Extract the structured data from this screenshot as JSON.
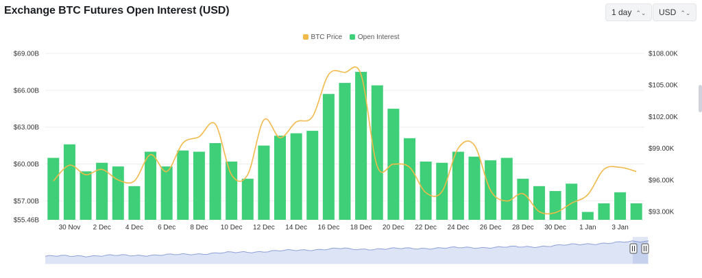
{
  "header": {
    "title": "Exchange BTC Futures Open Interest (USD)",
    "interval_select": "1 day",
    "currency_select": "USD"
  },
  "colors": {
    "bars": "#3ecf78",
    "price_line": "#f1b94a",
    "grid": "#eeeeee",
    "navigator_fill": "#dde4f6",
    "navigator_line": "#8da0d8"
  },
  "icons": {
    "select_chevron": "chevron-updown-icon",
    "navigator_handles": "pause-handle-icon"
  },
  "chart_data": {
    "type": "bar",
    "legend": [
      "BTC Price",
      "Open Interest"
    ],
    "x_tick_labels": [
      "30 Nov",
      "2 Dec",
      "4 Dec",
      "6 Dec",
      "8 Dec",
      "10 Dec",
      "12 Dec",
      "14 Dec",
      "16 Dec",
      "18 Dec",
      "20 Dec",
      "22 Dec",
      "24 Dec",
      "26 Dec",
      "28 Dec",
      "30 Dec",
      "1 Jan",
      "3 Jan"
    ],
    "left_axis": {
      "ticks": [
        {
          "value": 55.46,
          "label": "$55.46B"
        },
        {
          "value": 57.0,
          "label": "$57.00B"
        },
        {
          "value": 60.0,
          "label": "$60.00B"
        },
        {
          "value": 63.0,
          "label": "$63.00B"
        },
        {
          "value": 66.0,
          "label": "$66.00B"
        },
        {
          "value": 69.0,
          "label": "$69.00B"
        }
      ],
      "range": [
        55.46,
        69.0
      ]
    },
    "right_axis": {
      "ticks": [
        {
          "value": 93000,
          "label": "$93.00K"
        },
        {
          "value": 96000,
          "label": "$96.00K"
        },
        {
          "value": 99000,
          "label": "$99.00K"
        },
        {
          "value": 102000,
          "label": "$102.00K"
        },
        {
          "value": 105000,
          "label": "$105.00K"
        },
        {
          "value": 108000,
          "label": "$108.00K"
        }
      ],
      "range": [
        92600,
        108000
      ]
    },
    "series": [
      {
        "name": "Open Interest",
        "axis": "left",
        "values": [
          60.5,
          61.6,
          59.4,
          60.1,
          59.8,
          58.2,
          61.0,
          59.8,
          61.1,
          61.0,
          61.7,
          60.2,
          58.8,
          61.5,
          62.3,
          62.5,
          62.7,
          65.7,
          66.6,
          67.5,
          66.4,
          64.5,
          62.1,
          60.2,
          60.1,
          61.0,
          60.6,
          60.3,
          60.5,
          58.8,
          58.2,
          57.8,
          58.4,
          56.1,
          56.8,
          57.7,
          56.8
        ]
      },
      {
        "name": "BTC Price",
        "axis": "right",
        "values": [
          95900,
          97400,
          96500,
          97000,
          96000,
          95900,
          98400,
          96800,
          99500,
          100100,
          101300,
          96500,
          96500,
          101700,
          100000,
          101500,
          102000,
          106000,
          106200,
          106000,
          97300,
          97500,
          97200,
          94800,
          94900,
          99000,
          99300,
          95000,
          94000,
          94700,
          93000,
          92900,
          93800,
          94600,
          97000,
          97200,
          96800
        ]
      }
    ],
    "grid": true,
    "navigator": true
  }
}
